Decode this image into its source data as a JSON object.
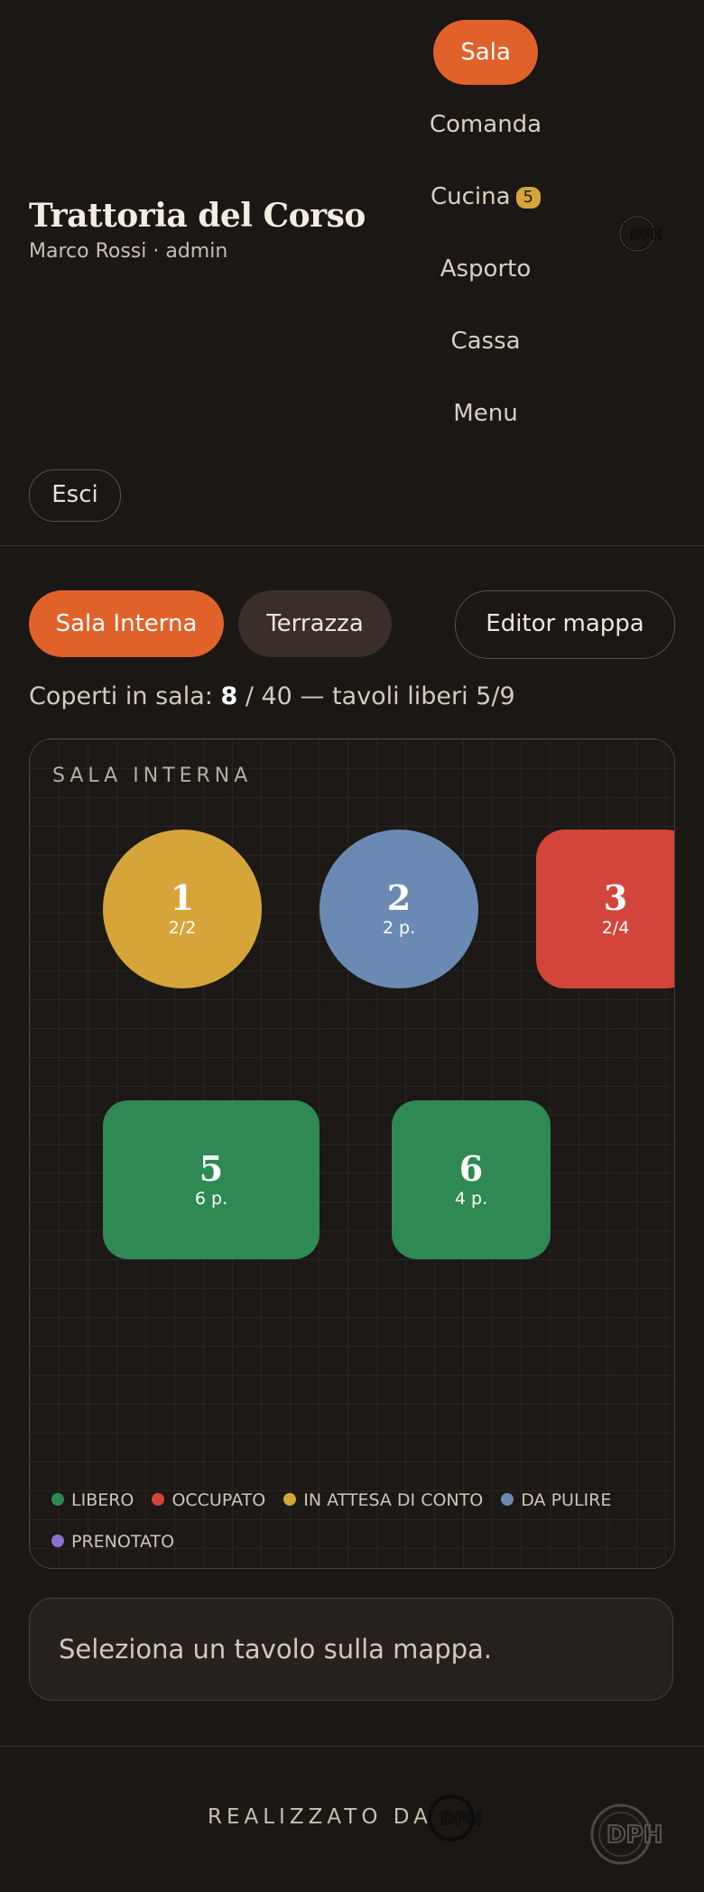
{
  "header": {
    "title": "Trattoria del Corso",
    "subtitle": "Marco Rossi · admin",
    "logout_label": "Esci"
  },
  "nav": {
    "items": [
      {
        "label": "Sala",
        "active": true
      },
      {
        "label": "Comanda"
      },
      {
        "label": "Cucina",
        "badge": "5"
      },
      {
        "label": "Asporto"
      },
      {
        "label": "Cassa"
      },
      {
        "label": "Menu"
      }
    ]
  },
  "room_tabs": {
    "sala_interna": "Sala Interna",
    "terrazza": "Terrazza",
    "editor": "Editor mappa"
  },
  "summary": {
    "prefix": "Coperti in sala: ",
    "covers": "8",
    "suffix": " / 40 — tavoli liberi 5/9"
  },
  "map": {
    "title": "SALA INTERNA",
    "tables": [
      {
        "number": "1",
        "seats": "2/2",
        "status": "in attesa di conto"
      },
      {
        "number": "2",
        "seats": "2 p.",
        "status": "da pulire"
      },
      {
        "number": "3",
        "seats": "2/4",
        "status": "occupato"
      },
      {
        "number": "5",
        "seats": "6 p.",
        "status": "libero"
      },
      {
        "number": "6",
        "seats": "4 p.",
        "status": "libero"
      }
    ],
    "legend": [
      {
        "label": "LIBERO",
        "color": "#2e8a52"
      },
      {
        "label": "OCCUPATO",
        "color": "#d3453a"
      },
      {
        "label": "IN ATTESA DI CONTO",
        "color": "#d6a53a"
      },
      {
        "label": "DA PULIRE",
        "color": "#6a8ab3"
      },
      {
        "label": "PRENOTATO",
        "color": "#8a6fd1"
      }
    ]
  },
  "selection": {
    "message": "Seleziona un tavolo sulla mappa."
  },
  "footer": {
    "credit": "REALIZZATO DA"
  },
  "colors": {
    "accent": "#e0622a",
    "libero": "#2e8a52",
    "occupato": "#d3453a",
    "attesa": "#d6a53a",
    "pulire": "#6a8ab3",
    "prenotato": "#8a6fd1"
  }
}
